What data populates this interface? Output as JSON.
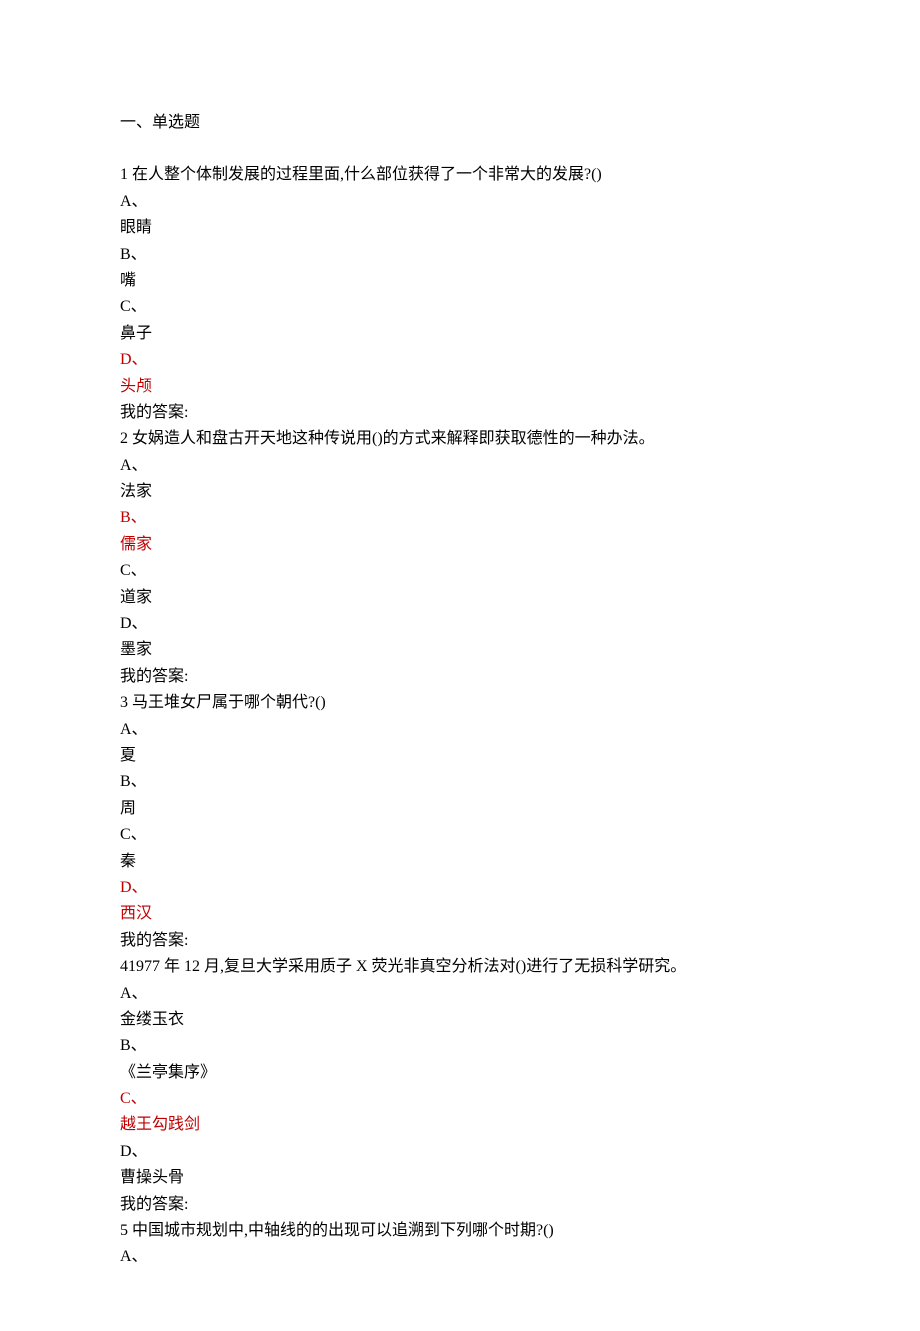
{
  "section_title": "一、单选题",
  "questions": [
    {
      "num": "1",
      "text": " 在人整个体制发展的过程里面,什么部位获得了一个非常大的发展?()",
      "pairs": [
        {
          "letter": "A、",
          "opt": "眼睛",
          "letter_red": false,
          "opt_red": false
        },
        {
          "letter": "B、",
          "opt": "嘴",
          "letter_red": false,
          "opt_red": false
        },
        {
          "letter": "C、",
          "opt": "鼻子",
          "letter_red": false,
          "opt_red": false
        },
        {
          "letter": "D、",
          "opt": "头颅",
          "letter_red": true,
          "opt_red": true
        }
      ],
      "answer_label": "我的答案:"
    },
    {
      "num": "2",
      "text": " 女娲造人和盘古开天地这种传说用()的方式来解释即获取德性的一种办法。",
      "pairs": [
        {
          "letter": "A、",
          "opt": "法家",
          "letter_red": false,
          "opt_red": false
        },
        {
          "letter": "B、",
          "opt": "儒家",
          "letter_red": true,
          "opt_red": true
        },
        {
          "letter": "C、",
          "opt": "道家",
          "letter_red": false,
          "opt_red": false
        },
        {
          "letter": "D、",
          "opt": "墨家",
          "letter_red": false,
          "opt_red": false
        }
      ],
      "answer_label": "我的答案:"
    },
    {
      "num": "3",
      "text": " 马王堆女尸属于哪个朝代?()",
      "pairs": [
        {
          "letter": "A、",
          "opt": "夏",
          "letter_red": false,
          "opt_red": false
        },
        {
          "letter": "B、",
          "opt": "周",
          "letter_red": false,
          "opt_red": false
        },
        {
          "letter": "C、",
          "opt": "秦",
          "letter_red": false,
          "opt_red": false
        },
        {
          "letter": "D、",
          "opt": "西汉",
          "letter_red": true,
          "opt_red": true
        }
      ],
      "answer_label": "我的答案:"
    },
    {
      "num": "4",
      "text": "1977 年 12 月,复旦大学采用质子 X 荧光非真空分析法对()进行了无损科学研究。",
      "pairs": [
        {
          "letter": "A、",
          "opt": "金缕玉衣",
          "letter_red": false,
          "opt_red": false
        },
        {
          "letter": "B、",
          "opt": "《兰亭集序》",
          "letter_red": false,
          "opt_red": false
        },
        {
          "letter": "C、",
          "opt": "越王勾践剑",
          "letter_red": true,
          "opt_red": true
        },
        {
          "letter": "D、",
          "opt": "曹操头骨",
          "letter_red": false,
          "opt_red": false
        }
      ],
      "answer_label": "我的答案:"
    },
    {
      "num": "5",
      "text": " 中国城市规划中,中轴线的的出现可以追溯到下列哪个时期?()",
      "pairs": [
        {
          "letter": "A、",
          "opt": "",
          "letter_red": false,
          "opt_red": false
        }
      ],
      "answer_label": ""
    }
  ]
}
